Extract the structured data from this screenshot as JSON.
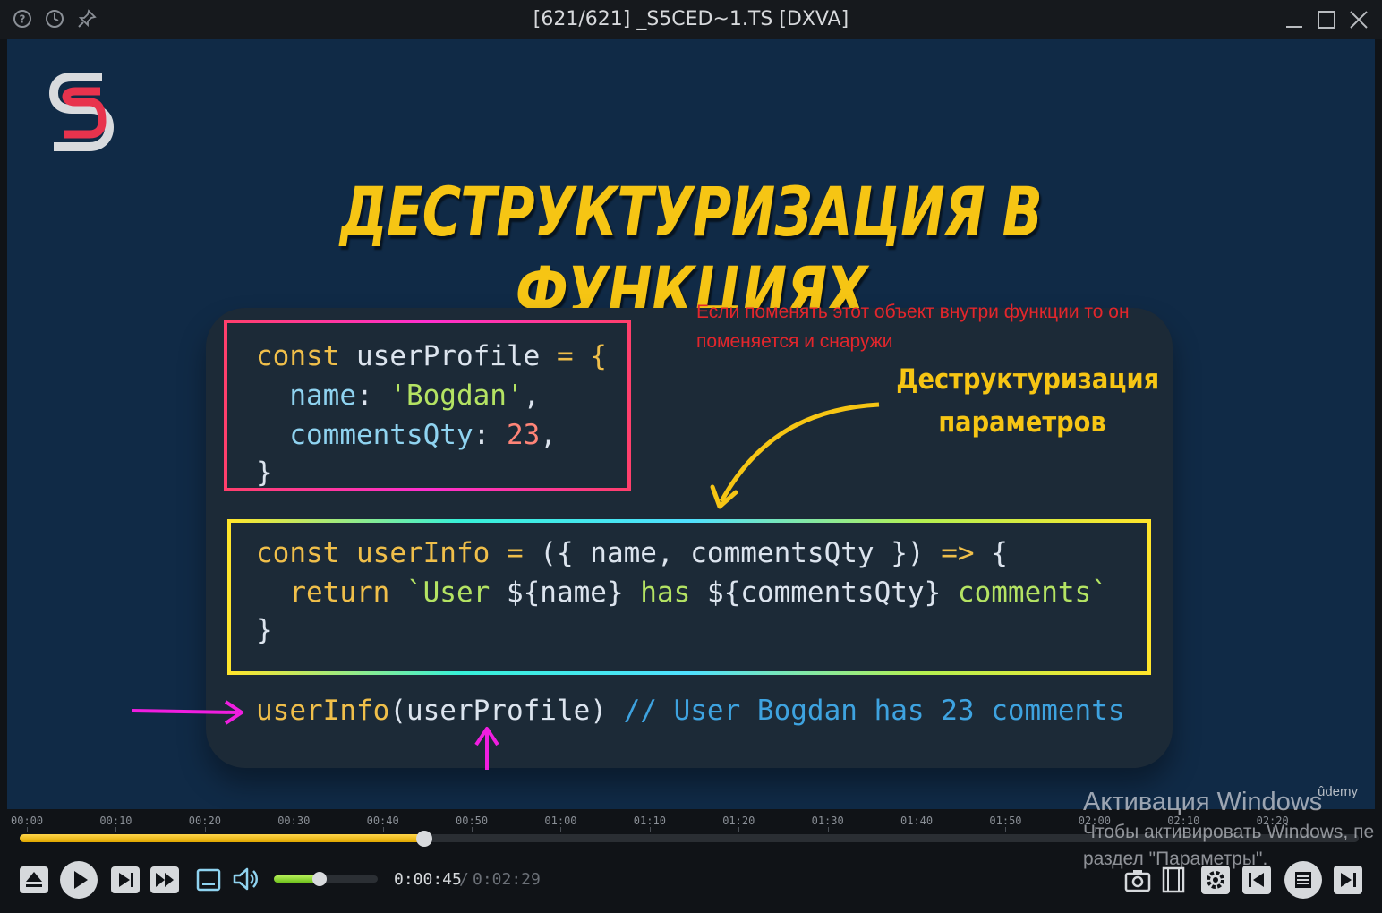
{
  "window": {
    "title": "[621/621] _S5CED~1.TS [DXVA]",
    "left_icons": [
      "help-icon",
      "history-icon",
      "pin-icon"
    ],
    "buttons": [
      "minimize-icon",
      "maximize-icon",
      "close-icon"
    ]
  },
  "slide": {
    "title": "ДЕСТРУКТУРИЗАЦИЯ В ФУНКЦИЯХ",
    "note": "Если поменять этот объект внутри функции то он поменяется и снаружи",
    "label_line1": "Деструктуризация",
    "label_line2": "параметров",
    "watermark": "ûdemy",
    "code": {
      "l1_kw": "const",
      "l1_id": " userProfile ",
      "l1_op": "= {",
      "l2_prop": "  name",
      "l2_colon": ": ",
      "l2_str": "'Bogdan'",
      "l2_comma": ",",
      "l3_prop": "  commentsQty",
      "l3_colon": ": ",
      "l3_num": "23",
      "l3_comma": ",",
      "l4": "}",
      "f1_kw": "const",
      "f1_fn": " userInfo ",
      "f1_eq": "= ",
      "f1_params": "({ name, commentsQty }) ",
      "f1_arrow": "=> ",
      "f1_brace": "{",
      "f2_ret": "  return ",
      "f2_tpl1": "`User ",
      "f2_v1": "${name}",
      "f2_tpl2": " has ",
      "f2_v2": "${commentsQty}",
      "f2_tpl3": " comments`",
      "f3": "}",
      "call_fn": "userInfo",
      "call_args": "(userProfile)",
      "call_comment": " // User Bogdan has 23 comments"
    }
  },
  "timeline": {
    "ticks": [
      "00:00",
      "00:10",
      "00:20",
      "00:30",
      "00:40",
      "00:50",
      "01:00",
      "01:10",
      "01:20",
      "01:30",
      "01:40",
      "01:50",
      "02:00",
      "02:10",
      "02:20"
    ],
    "progress": 0.302
  },
  "player": {
    "current_time": "0:00:45",
    "separator": "/",
    "total_time": "0:02:29",
    "volume": 0.44,
    "left_controls": [
      "eject-icon",
      "play-icon",
      "step-forward-icon",
      "fast-forward-icon",
      "subtitles-icon",
      "volume-icon"
    ],
    "right_controls": [
      "screenshot-icon",
      "film-icon",
      "settings-icon",
      "previous-icon",
      "playlist-icon",
      "next-icon"
    ]
  },
  "activation": {
    "title": "Активация Windows",
    "line2": "Чтобы активировать Windows, пе",
    "line3": "раздел \"Параметры\"."
  },
  "colors": {
    "title_yellow": "#f6c514",
    "note_red": "#e3262c",
    "seek_fill": "#f0b800",
    "volume_fill": "#8fd83a"
  }
}
